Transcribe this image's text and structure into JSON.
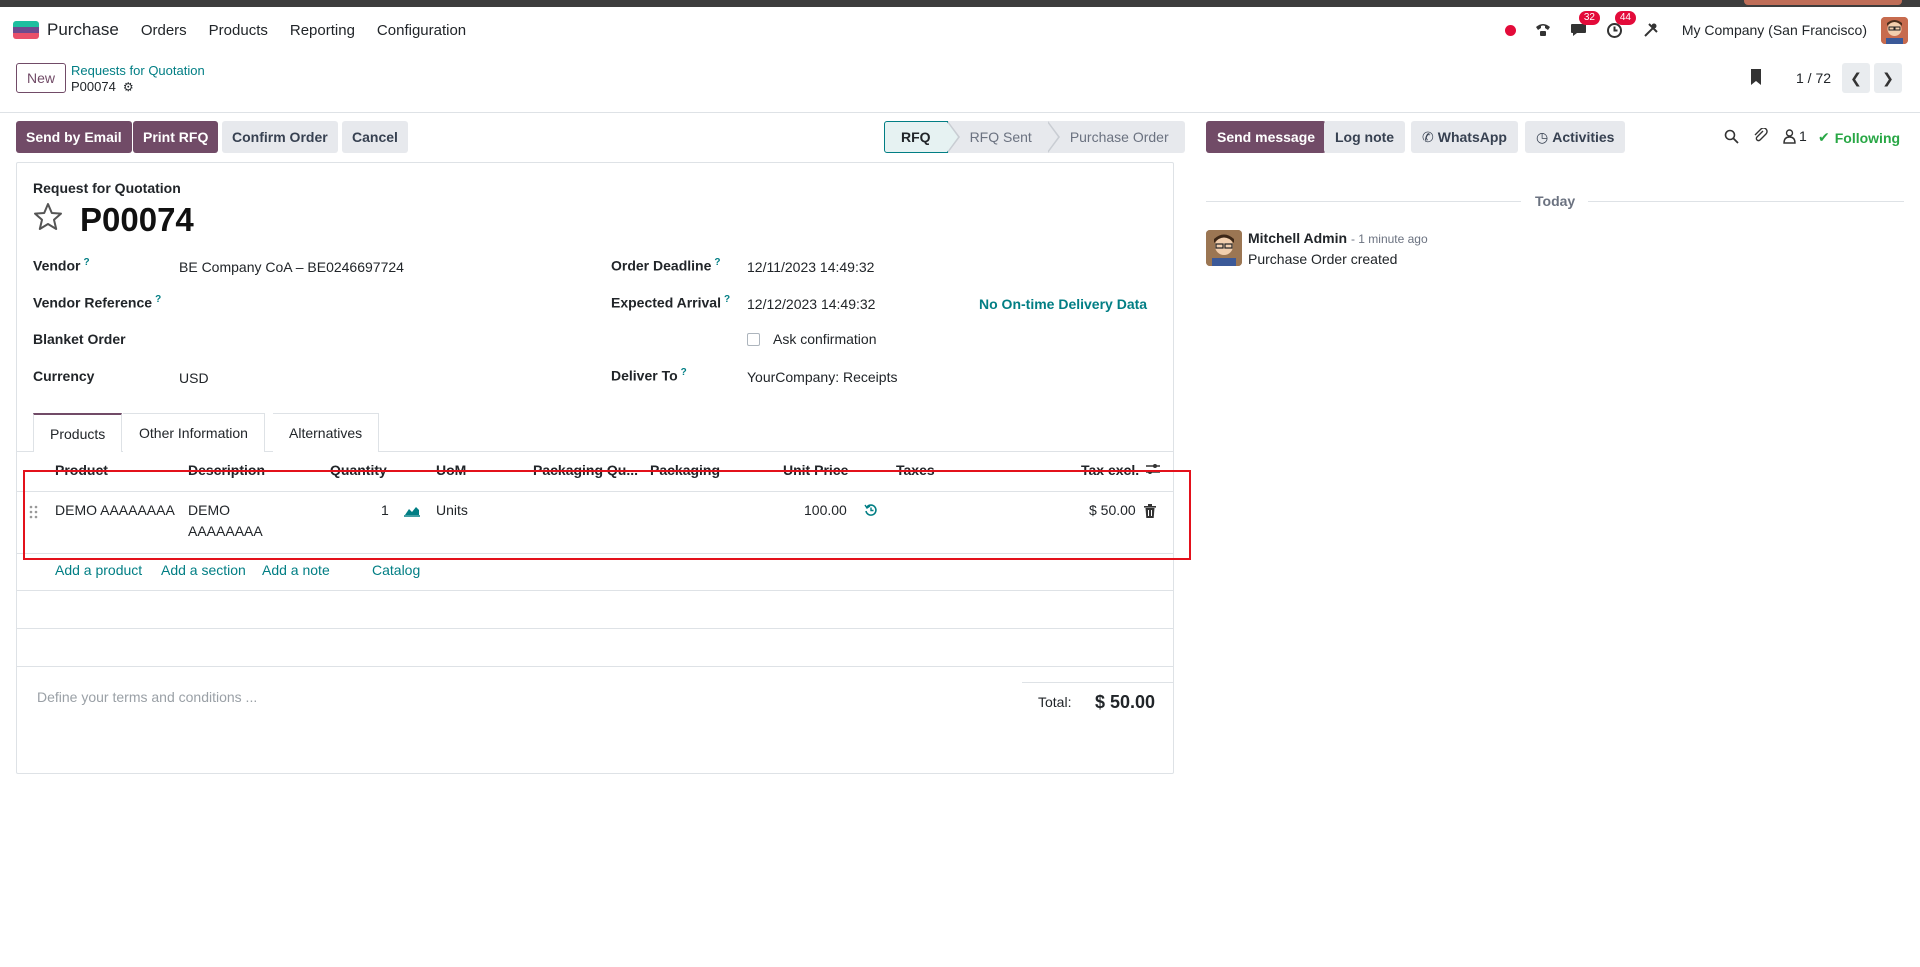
{
  "navbar": {
    "app_name": "Purchase",
    "menu": [
      "Orders",
      "Products",
      "Reporting",
      "Configuration"
    ],
    "discuss_badge": "32",
    "activity_badge": "44",
    "company": "My Company (San Francisco)"
  },
  "control_panel": {
    "new_label": "New",
    "breadcrumb_parent": "Requests for Quotation",
    "breadcrumb_current": "P00074",
    "pager": "1 / 72"
  },
  "actions": {
    "send_by_email": "Send by Email",
    "print_rfq": "Print RFQ",
    "confirm_order": "Confirm Order",
    "cancel": "Cancel"
  },
  "statusbar": {
    "stages": [
      "RFQ",
      "RFQ Sent",
      "Purchase Order"
    ],
    "active": "RFQ"
  },
  "form": {
    "title_label": "Request for Quotation",
    "record_name": "P00074",
    "vendor_label": "Vendor",
    "vendor_value": "BE Company CoA – BE0246697724",
    "vendor_ref_label": "Vendor Reference",
    "blanket_order_label": "Blanket Order",
    "currency_label": "Currency",
    "currency_value": "USD",
    "order_deadline_label": "Order Deadline",
    "order_deadline_value": "12/11/2023 14:49:32",
    "expected_arrival_label": "Expected Arrival",
    "expected_arrival_value": "12/12/2023 14:49:32",
    "delivery_data": "No On-time Delivery Data",
    "ask_confirmation_label": "Ask confirmation",
    "deliver_to_label": "Deliver To",
    "deliver_to_value": "YourCompany: Receipts",
    "help_mark": "?"
  },
  "tabs": [
    "Products",
    "Other Information",
    "Alternatives"
  ],
  "lines_table": {
    "columns": [
      "Product",
      "Description",
      "Quantity",
      "UoM",
      "Packaging Qu...",
      "Packaging",
      "Unit Price",
      "Taxes",
      "Tax excl."
    ],
    "rows": [
      {
        "product": "DEMO AAAAAAAA",
        "description_line1": "DEMO",
        "description_line2": "AAAAAAAA",
        "quantity": "1",
        "uom": "Units",
        "unit_price": "100.00",
        "subtotal": "$ 50.00"
      }
    ],
    "add_links": [
      "Add a product",
      "Add a section",
      "Add a note",
      "Catalog"
    ]
  },
  "footer": {
    "terms_placeholder": "Define your terms and conditions ...",
    "total_label": "Total:",
    "total_value": "$ 50.00"
  },
  "chatter": {
    "send_message": "Send message",
    "log_note": "Log note",
    "whatsapp": "WhatsApp",
    "activities": "Activities",
    "followers_count": "1",
    "following": "Following",
    "date_separator": "Today",
    "message": {
      "author": "Mitchell Admin",
      "time": "- 1 minute ago",
      "body": "Purchase Order created"
    }
  },
  "colors": {
    "brand": "#714b67",
    "link": "#017e84",
    "highlight_box": "#e3111b",
    "following": "#28a745"
  }
}
